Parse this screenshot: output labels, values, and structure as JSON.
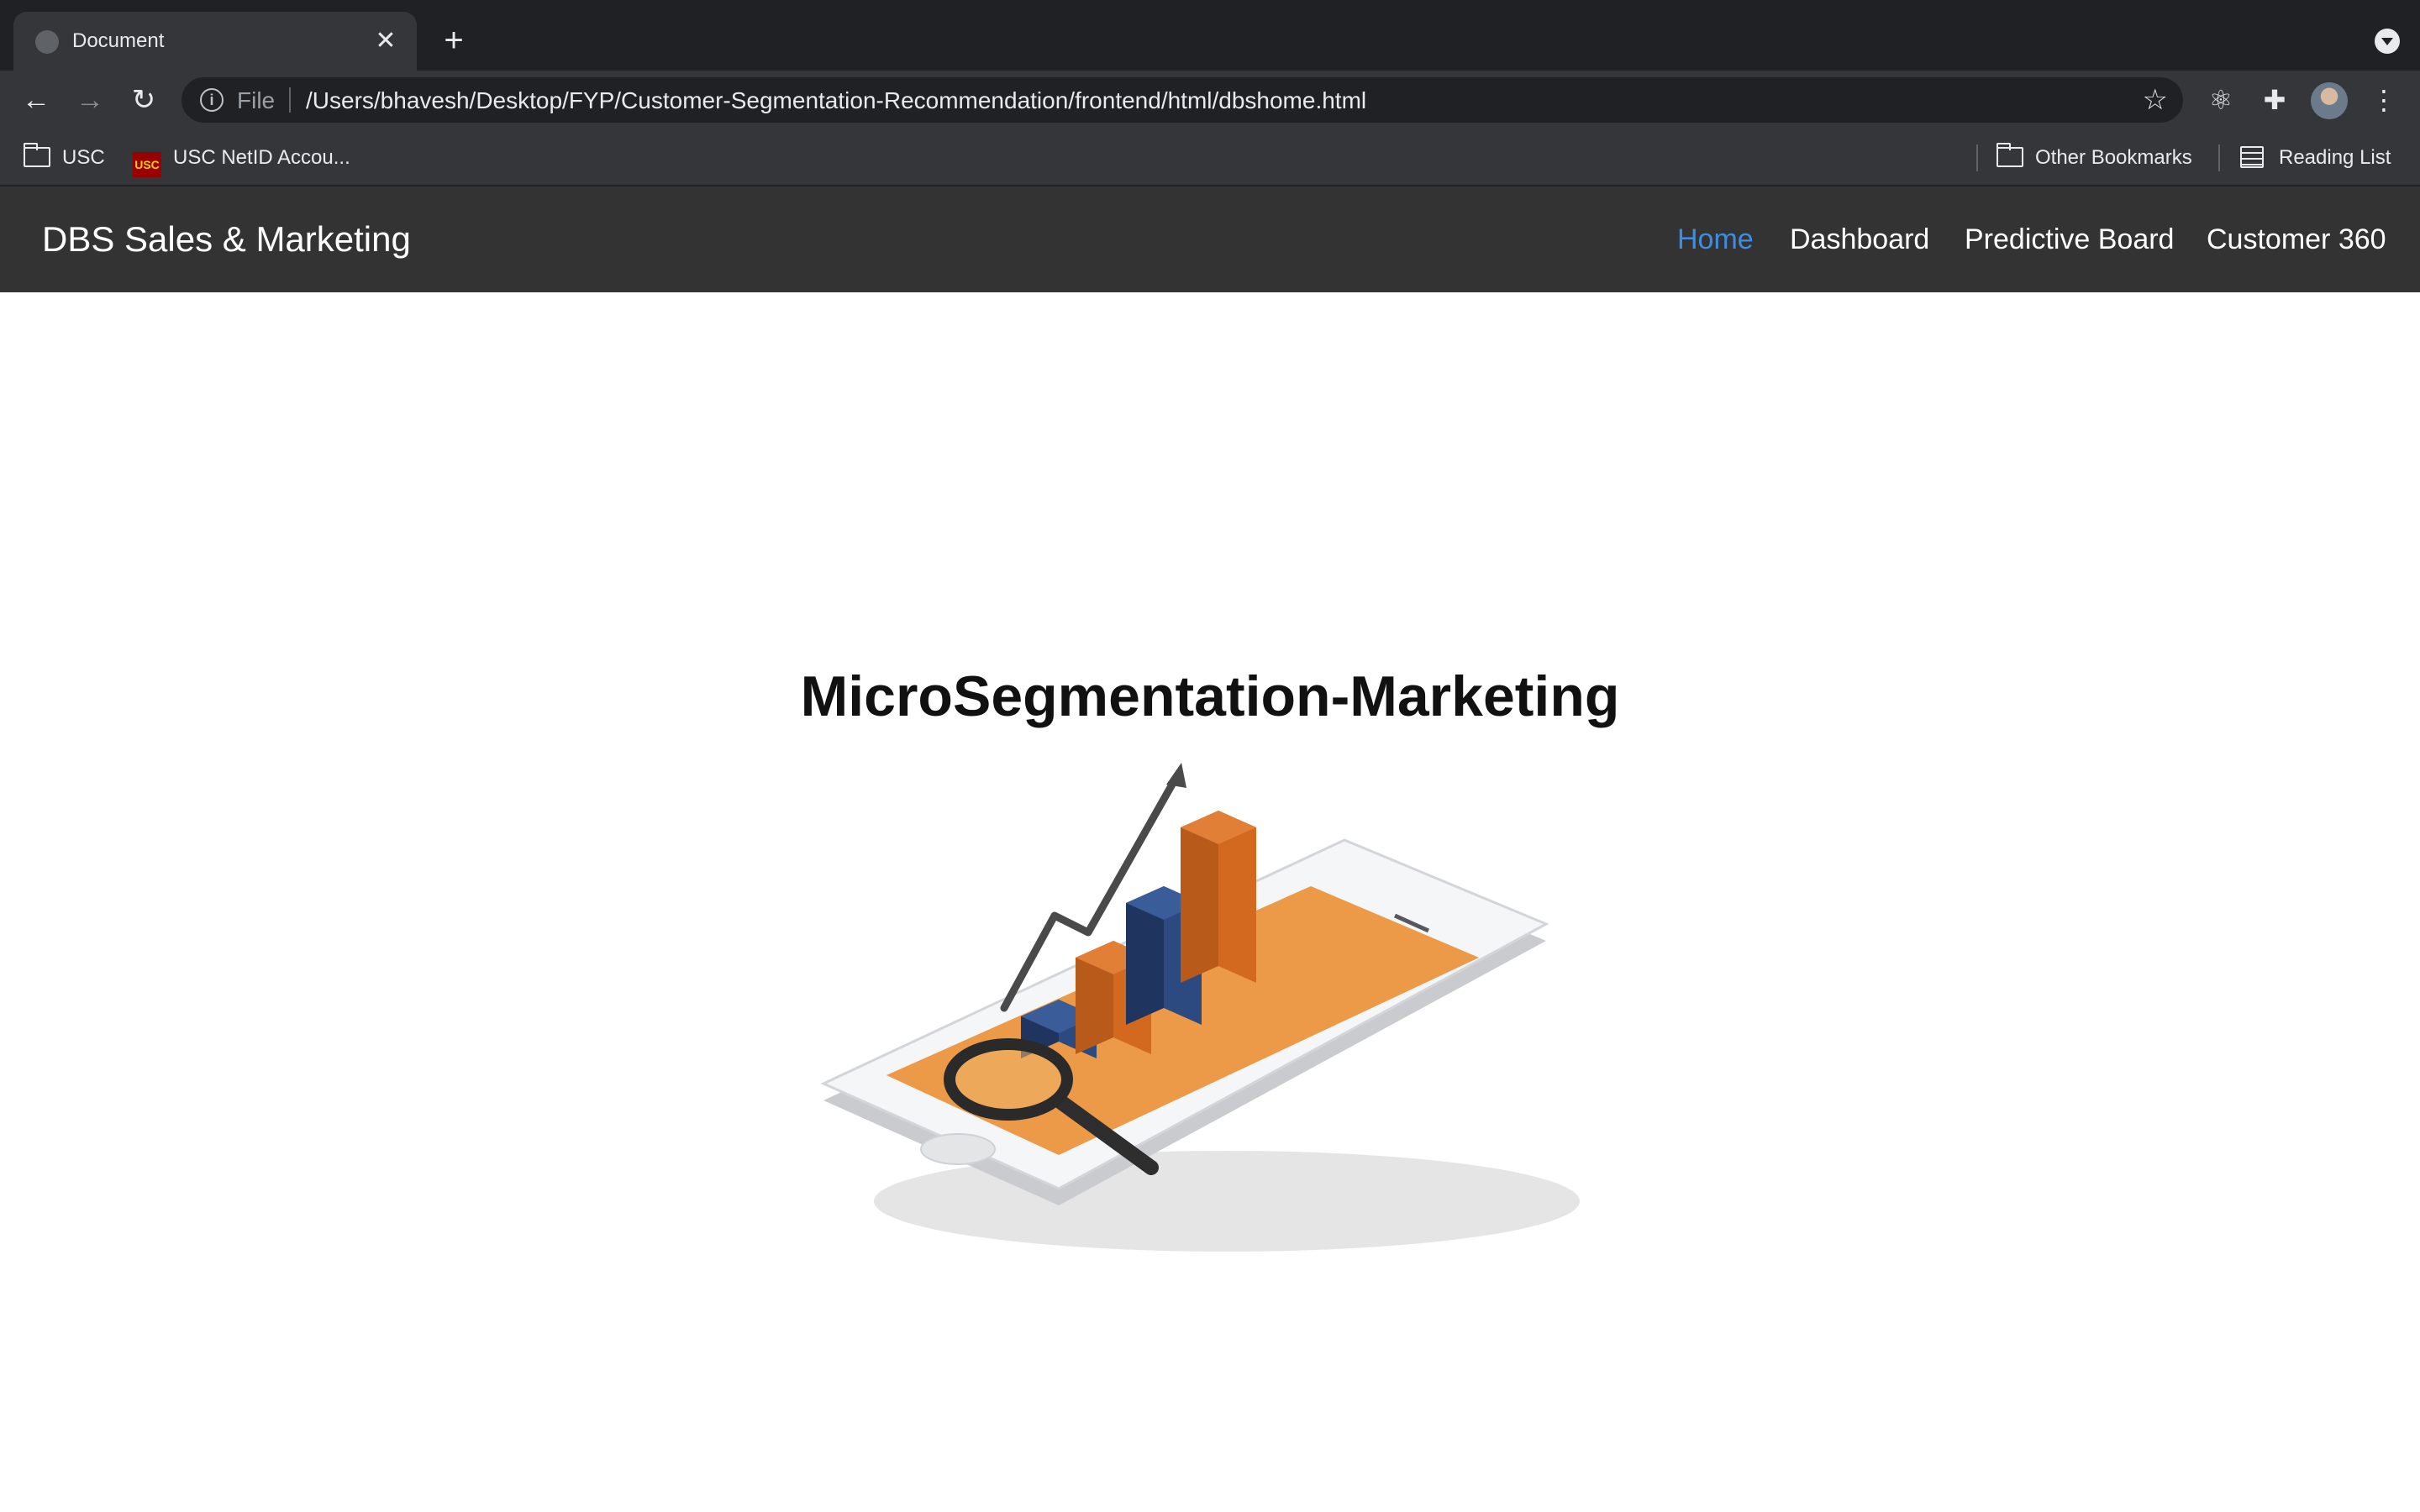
{
  "browser": {
    "tab_title": "Document",
    "tab_close": "✕",
    "new_tab": "+",
    "url_scheme": "File",
    "url": "/Users/bhavesh/Desktop/FYP/Customer-Segmentation-Recommendation/frontend/html/dbshome.html",
    "bookmarks": [
      {
        "label": "USC",
        "icon": "folder-icon"
      },
      {
        "label": "USC NetID Accou...",
        "icon": "usc-favicon",
        "favicon_text": "USC"
      },
      {
        "label": "Other Bookmarks",
        "icon": "folder-icon"
      },
      {
        "label": "Reading List",
        "icon": "reading-list-icon"
      }
    ]
  },
  "site": {
    "brand": "DBS Sales & Marketing",
    "nav": [
      {
        "label": "Home",
        "active": true
      },
      {
        "label": "Dashboard",
        "active": false
      },
      {
        "label": "Predictive Board",
        "active": false
      },
      {
        "label": "Customer 360",
        "active": false
      }
    ],
    "headline": "MicroSegmentation-Marketing",
    "hero_image": "isometric-phone-bar-chart-magnifier-illustration"
  },
  "colors": {
    "chrome_dark": "#202124",
    "chrome_toolbar": "#35363a",
    "navbar_bg": "#333333",
    "nav_active": "#3f8de0",
    "chart_orange": "#d2691e",
    "chart_navy": "#243a66"
  }
}
